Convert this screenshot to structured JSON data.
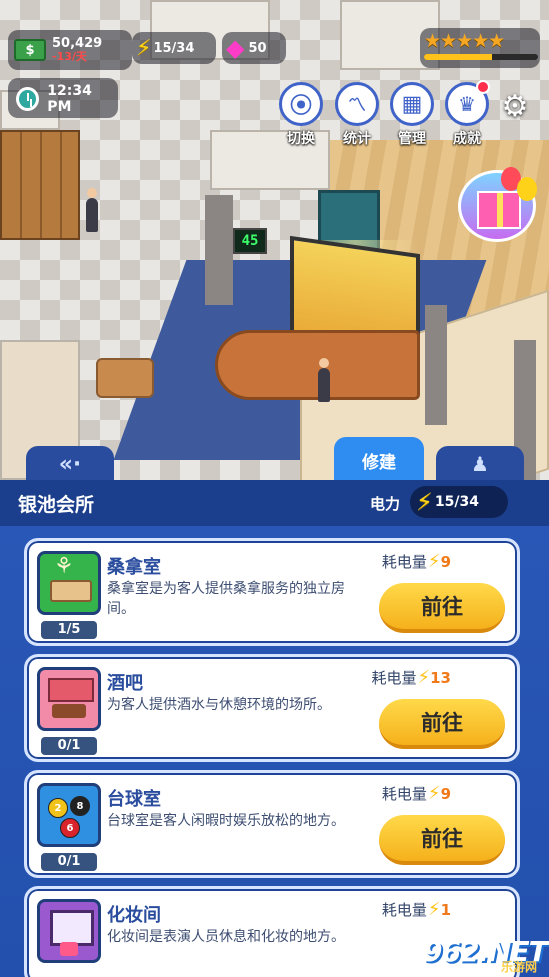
{
  "hud": {
    "money": "50,429",
    "money_rate": "-13/天",
    "money_icon_label": "$",
    "power": "15/34",
    "gems": "50",
    "time": "12:34 PM",
    "stars": "★★★★★",
    "star_progress": 0.6
  },
  "scene": {
    "floor_sign": "45"
  },
  "menu": [
    {
      "label": "切换",
      "icon": "location-icon",
      "glyph": "⦿"
    },
    {
      "label": "统计",
      "icon": "chart-icon",
      "glyph": "📈"
    },
    {
      "label": "管理",
      "icon": "grid-icon",
      "glyph": "▦"
    },
    {
      "label": "成就",
      "icon": "trophy-icon",
      "glyph": "🏆"
    }
  ],
  "tabs": {
    "back_glyph": "«·",
    "build_label": "修建",
    "staff_glyph": "👤"
  },
  "panel": {
    "title": "银池会所",
    "power_label": "电力",
    "power_value": "15/34"
  },
  "rooms": [
    {
      "name": "桑拿室",
      "desc": "桑拿室是为客人提供桑拿服务的独立房间。",
      "count": "1/5",
      "cost_label": "耗电量",
      "cost": "9",
      "button": "前往",
      "icon": "sauna-icon"
    },
    {
      "name": "酒吧",
      "desc": "为客人提供酒水与休憩环境的场所。",
      "count": "0/1",
      "cost_label": "耗电量",
      "cost": "13",
      "button": "前往",
      "icon": "bar-icon"
    },
    {
      "name": "台球室",
      "desc": "台球室是客人闲暇时娱乐放松的地方。",
      "count": "0/1",
      "cost_label": "耗电量",
      "cost": "9",
      "button": "前往",
      "icon": "billiards-icon"
    },
    {
      "name": "化妆间",
      "desc": "化妆间是表演人员休息和化妆的地方。",
      "count": "",
      "cost_label": "耗电量",
      "cost": "1",
      "button": "",
      "icon": "makeup-icon"
    }
  ],
  "watermark": {
    "logo": "962.NET",
    "sub": "乐游网"
  },
  "colors": {
    "accent": "#2f8cf0",
    "panel": "#2350ad",
    "button": "#f5b11c",
    "cost": "#f07a1a"
  }
}
